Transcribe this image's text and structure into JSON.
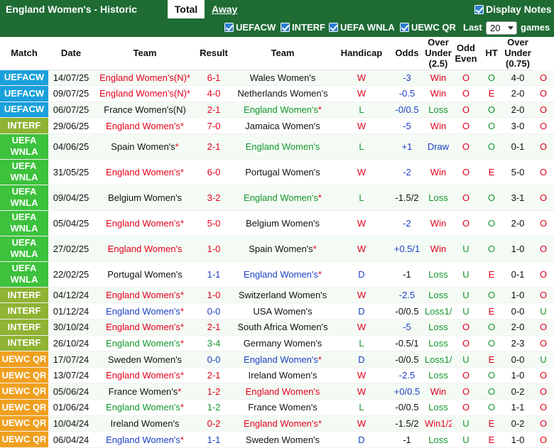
{
  "header": {
    "title": "England Women's - Historic scores",
    "tab_total": "Total",
    "tab_away": "Away",
    "display_notes": "Display Notes"
  },
  "filters": {
    "uefacw": "UEFACW",
    "interf": "INTERF",
    "uefa_wnla": "UEFA WNLA",
    "uewc_qr": "UEWC QR",
    "last_label": "Last",
    "last_value": "20",
    "games_label": "games"
  },
  "columns": {
    "match": "Match",
    "date": "Date",
    "team1": "Team",
    "result": "Result",
    "team2": "Team",
    "handicap": "Handicap",
    "odds": "Odds",
    "over_under": "Over Under (2.5)",
    "odd_even": "Odd Even",
    "ht": "HT",
    "over_under2": "Over Under (0.75)"
  },
  "colors": {
    "header_green": "#1e6b34",
    "uefacw": "#1aa0dc",
    "interf": "#8fb332",
    "wnla": "#3cc23c",
    "uewc": "#f0a020",
    "win_red": "#e3001b",
    "loss_green": "#14962e",
    "draw_blue": "#1d3fc4"
  },
  "rows": [
    {
      "comp": "UEFACW",
      "cls": "c-uefacw",
      "date": "14/07/25",
      "home": "England Women's(N)",
      "hstar": "*",
      "hc": "red",
      "score": "6-1",
      "sc": "red",
      "away": "Wales Women's",
      "astar": "",
      "ac": "dark",
      "res": "W",
      "rc": "red",
      "hcp": "-3",
      "hcpc": "blue",
      "odds": "Win",
      "oc": "red",
      "ou": "O",
      "ouc": "red",
      "oe": "O",
      "oec": "green",
      "ht": "4-0",
      "ou2": "O",
      "ou2c": "red"
    },
    {
      "comp": "UEFACW",
      "cls": "c-uefacw",
      "date": "09/07/25",
      "home": "England Women's(N)",
      "hstar": "*",
      "hc": "red",
      "score": "4-0",
      "sc": "red",
      "away": "Netherlands Women's",
      "astar": "",
      "ac": "dark",
      "res": "W",
      "rc": "red",
      "hcp": "-0.5",
      "hcpc": "blue",
      "odds": "Win",
      "oc": "red",
      "ou": "O",
      "ouc": "red",
      "oe": "E",
      "oec": "red",
      "ht": "2-0",
      "ou2": "O",
      "ou2c": "red"
    },
    {
      "comp": "UEFACW",
      "cls": "c-uefacw",
      "date": "06/07/25",
      "home": "France Women's(N)",
      "hstar": "",
      "hc": "dark",
      "score": "2-1",
      "sc": "red",
      "away": "England Women's",
      "astar": "*",
      "ac": "green",
      "res": "L",
      "rc": "green",
      "hcp": "-0/0.5",
      "hcpc": "blue",
      "odds": "Loss",
      "oc": "green",
      "ou": "O",
      "ouc": "red",
      "oe": "O",
      "oec": "green",
      "ht": "2-0",
      "ou2": "O",
      "ou2c": "red"
    },
    {
      "comp": "INTERF",
      "cls": "c-interf",
      "date": "29/06/25",
      "home": "England Women's",
      "hstar": "*",
      "hc": "red",
      "score": "7-0",
      "sc": "red",
      "away": "Jamaica Women's",
      "astar": "",
      "ac": "dark",
      "res": "W",
      "rc": "red",
      "hcp": "-5",
      "hcpc": "blue",
      "odds": "Win",
      "oc": "red",
      "ou": "O",
      "ouc": "red",
      "oe": "O",
      "oec": "green",
      "ht": "3-0",
      "ou2": "O",
      "ou2c": "red"
    },
    {
      "comp": "UEFA WNLA",
      "cls": "c-wnla",
      "date": "04/06/25",
      "home": "Spain Women's",
      "hstar": "*",
      "hc": "dark",
      "score": "2-1",
      "sc": "red",
      "away": "England Women's",
      "astar": "",
      "ac": "green",
      "res": "L",
      "rc": "green",
      "hcp": "+1",
      "hcpc": "blue",
      "odds": "Draw",
      "oc": "blue",
      "ou": "O",
      "ouc": "red",
      "oe": "O",
      "oec": "green",
      "ht": "0-1",
      "ou2": "O",
      "ou2c": "red"
    },
    {
      "comp": "UEFA WNLA",
      "cls": "c-wnla",
      "date": "31/05/25",
      "home": "England Women's",
      "hstar": "*",
      "hc": "red",
      "score": "6-0",
      "sc": "red",
      "away": "Portugal Women's",
      "astar": "",
      "ac": "dark",
      "res": "W",
      "rc": "red",
      "hcp": "-2",
      "hcpc": "blue",
      "odds": "Win",
      "oc": "red",
      "ou": "O",
      "ouc": "red",
      "oe": "E",
      "oec": "red",
      "ht": "5-0",
      "ou2": "O",
      "ou2c": "red"
    },
    {
      "comp": "UEFA WNLA",
      "cls": "c-wnla",
      "date": "09/04/25",
      "home": "Belgium Women's",
      "hstar": "",
      "hc": "dark",
      "score": "3-2",
      "sc": "red",
      "away": "England Women's",
      "astar": "*",
      "ac": "green",
      "res": "L",
      "rc": "green",
      "hcp": "-1.5/2",
      "hcpc": "dark",
      "odds": "Loss",
      "oc": "green",
      "ou": "O",
      "ouc": "red",
      "oe": "O",
      "oec": "green",
      "ht": "3-1",
      "ou2": "O",
      "ou2c": "red"
    },
    {
      "comp": "UEFA WNLA",
      "cls": "c-wnla",
      "date": "05/04/25",
      "home": "England Women's",
      "hstar": "*",
      "hc": "red",
      "score": "5-0",
      "sc": "red",
      "away": "Belgium Women's",
      "astar": "",
      "ac": "dark",
      "res": "W",
      "rc": "red",
      "hcp": "-2",
      "hcpc": "blue",
      "odds": "Win",
      "oc": "red",
      "ou": "O",
      "ouc": "red",
      "oe": "O",
      "oec": "green",
      "ht": "2-0",
      "ou2": "O",
      "ou2c": "red"
    },
    {
      "comp": "UEFA WNLA",
      "cls": "c-wnla",
      "date": "27/02/25",
      "home": "England Women's",
      "hstar": "",
      "hc": "red",
      "score": "1-0",
      "sc": "red",
      "away": "Spain Women's",
      "astar": "*",
      "ac": "dark",
      "res": "W",
      "rc": "red",
      "hcp": "+0.5/1",
      "hcpc": "blue",
      "odds": "Win",
      "oc": "red",
      "ou": "U",
      "ouc": "green",
      "oe": "O",
      "oec": "green",
      "ht": "1-0",
      "ou2": "O",
      "ou2c": "red"
    },
    {
      "comp": "UEFA WNLA",
      "cls": "c-wnla",
      "date": "22/02/25",
      "home": "Portugal Women's",
      "hstar": "",
      "hc": "dark",
      "score": "1-1",
      "sc": "blue",
      "away": "England Women's",
      "astar": "*",
      "ac": "blue",
      "res": "D",
      "rc": "blue",
      "hcp": "-1",
      "hcpc": "dark",
      "odds": "Loss",
      "oc": "green",
      "ou": "U",
      "ouc": "green",
      "oe": "E",
      "oec": "red",
      "ht": "0-1",
      "ou2": "O",
      "ou2c": "red"
    },
    {
      "comp": "INTERF",
      "cls": "c-interf",
      "date": "04/12/24",
      "home": "England Women's",
      "hstar": "*",
      "hc": "red",
      "score": "1-0",
      "sc": "red",
      "away": "Switzerland Women's",
      "astar": "",
      "ac": "dark",
      "res": "W",
      "rc": "red",
      "hcp": "-2.5",
      "hcpc": "blue",
      "odds": "Loss",
      "oc": "green",
      "ou": "U",
      "ouc": "green",
      "oe": "O",
      "oec": "green",
      "ht": "1-0",
      "ou2": "O",
      "ou2c": "red"
    },
    {
      "comp": "INTERF",
      "cls": "c-interf",
      "date": "01/12/24",
      "home": "England Women's",
      "hstar": "*",
      "hc": "blue",
      "score": "0-0",
      "sc": "blue",
      "away": "USA Women's",
      "astar": "",
      "ac": "dark",
      "res": "D",
      "rc": "blue",
      "hcp": "-0/0.5",
      "hcpc": "dark",
      "odds": "Loss1/2",
      "oc": "green",
      "ou": "U",
      "ouc": "green",
      "oe": "E",
      "oec": "red",
      "ht": "0-0",
      "ou2": "U",
      "ou2c": "green"
    },
    {
      "comp": "INTERF",
      "cls": "c-interf",
      "date": "30/10/24",
      "home": "England Women's",
      "hstar": "*",
      "hc": "red",
      "score": "2-1",
      "sc": "red",
      "away": "South Africa Women's",
      "astar": "",
      "ac": "dark",
      "res": "W",
      "rc": "red",
      "hcp": "-5",
      "hcpc": "blue",
      "odds": "Loss",
      "oc": "green",
      "ou": "O",
      "ouc": "red",
      "oe": "O",
      "oec": "green",
      "ht": "2-0",
      "ou2": "O",
      "ou2c": "red"
    },
    {
      "comp": "INTERF",
      "cls": "c-interf",
      "date": "26/10/24",
      "home": "England Women's",
      "hstar": "*",
      "hc": "green",
      "score": "3-4",
      "sc": "green",
      "away": "Germany Women's",
      "astar": "",
      "ac": "dark",
      "res": "L",
      "rc": "green",
      "hcp": "-0.5/1",
      "hcpc": "dark",
      "odds": "Loss",
      "oc": "green",
      "ou": "O",
      "ouc": "red",
      "oe": "O",
      "oec": "green",
      "ht": "2-3",
      "ou2": "O",
      "ou2c": "red"
    },
    {
      "comp": "UEWC QR",
      "cls": "c-uewc",
      "date": "17/07/24",
      "home": "Sweden Women's",
      "hstar": "",
      "hc": "dark",
      "score": "0-0",
      "sc": "blue",
      "away": "England Women's",
      "astar": "*",
      "ac": "blue",
      "res": "D",
      "rc": "blue",
      "hcp": "-0/0.5",
      "hcpc": "dark",
      "odds": "Loss1/2",
      "oc": "green",
      "ou": "U",
      "ouc": "green",
      "oe": "E",
      "oec": "red",
      "ht": "0-0",
      "ou2": "U",
      "ou2c": "green"
    },
    {
      "comp": "UEWC QR",
      "cls": "c-uewc",
      "date": "13/07/24",
      "home": "England Women's",
      "hstar": "*",
      "hc": "red",
      "score": "2-1",
      "sc": "red",
      "away": "Ireland Women's",
      "astar": "",
      "ac": "dark",
      "res": "W",
      "rc": "red",
      "hcp": "-2.5",
      "hcpc": "blue",
      "odds": "Loss",
      "oc": "green",
      "ou": "O",
      "ouc": "red",
      "oe": "O",
      "oec": "green",
      "ht": "1-0",
      "ou2": "O",
      "ou2c": "red"
    },
    {
      "comp": "UEWC QR",
      "cls": "c-uewc",
      "date": "05/06/24",
      "home": "France Women's",
      "hstar": "*",
      "hc": "dark",
      "score": "1-2",
      "sc": "red",
      "away": "England Women's",
      "astar": "",
      "ac": "red",
      "res": "W",
      "rc": "red",
      "hcp": "+0/0.5",
      "hcpc": "blue",
      "odds": "Win",
      "oc": "red",
      "ou": "O",
      "ouc": "red",
      "oe": "O",
      "oec": "green",
      "ht": "0-2",
      "ou2": "O",
      "ou2c": "red"
    },
    {
      "comp": "UEWC QR",
      "cls": "c-uewc",
      "date": "01/06/24",
      "home": "England Women's",
      "hstar": "*",
      "hc": "green",
      "score": "1-2",
      "sc": "green",
      "away": "France Women's",
      "astar": "",
      "ac": "dark",
      "res": "L",
      "rc": "green",
      "hcp": "-0/0.5",
      "hcpc": "dark",
      "odds": "Loss",
      "oc": "green",
      "ou": "O",
      "ouc": "red",
      "oe": "O",
      "oec": "green",
      "ht": "1-1",
      "ou2": "O",
      "ou2c": "red"
    },
    {
      "comp": "UEWC QR",
      "cls": "c-uewc",
      "date": "10/04/24",
      "home": "Ireland Women's",
      "hstar": "",
      "hc": "dark",
      "score": "0-2",
      "sc": "red",
      "away": "England Women's",
      "astar": "*",
      "ac": "red",
      "res": "W",
      "rc": "red",
      "hcp": "-1.5/2",
      "hcpc": "dark",
      "odds": "Win1/2",
      "oc": "red",
      "ou": "U",
      "ouc": "green",
      "oe": "E",
      "oec": "red",
      "ht": "0-2",
      "ou2": "O",
      "ou2c": "red"
    },
    {
      "comp": "UEWC QR",
      "cls": "c-uewc",
      "date": "06/04/24",
      "home": "England Women's",
      "hstar": "*",
      "hc": "blue",
      "score": "1-1",
      "sc": "blue",
      "away": "Sweden Women's",
      "astar": "",
      "ac": "dark",
      "res": "D",
      "rc": "blue",
      "hcp": "-1",
      "hcpc": "dark",
      "odds": "Loss",
      "oc": "green",
      "ou": "U",
      "ouc": "green",
      "oe": "E",
      "oec": "red",
      "ht": "1-0",
      "ou2": "O",
      "ou2c": "red"
    }
  ]
}
